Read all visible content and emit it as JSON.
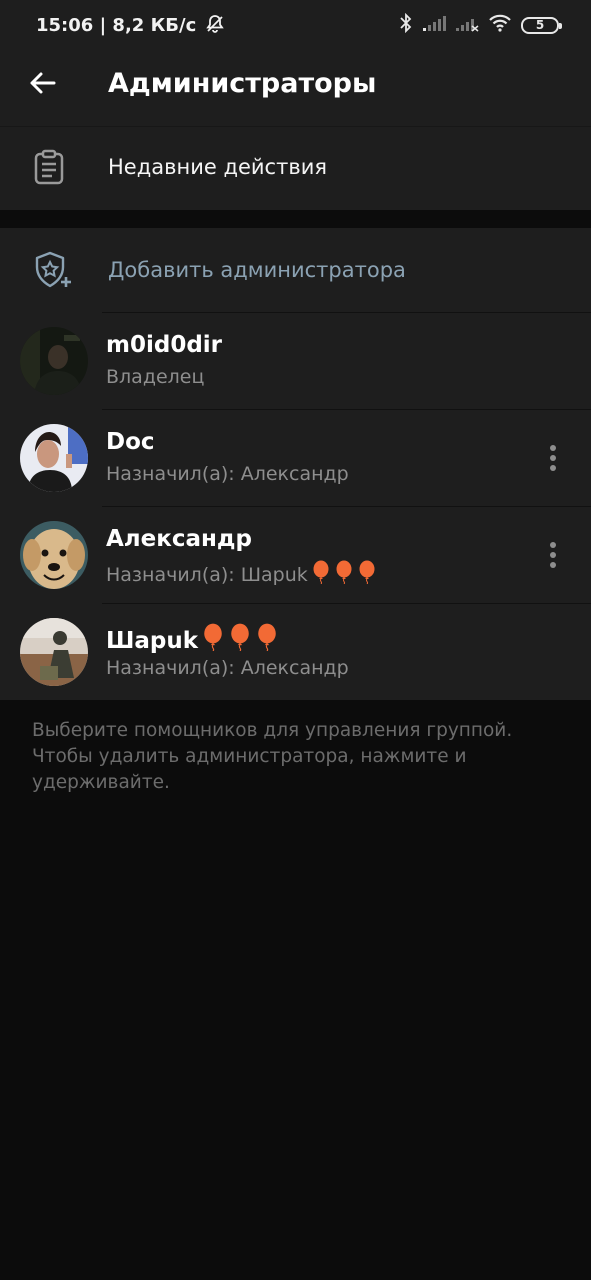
{
  "status_bar": {
    "time": "15:06",
    "speed": "| 8,2 КБ/с",
    "battery_level": "5"
  },
  "header": {
    "title": "Администраторы"
  },
  "recent_actions": {
    "label": "Недавние действия"
  },
  "add_admin": {
    "label": "Добавить администратора"
  },
  "admins": [
    {
      "name": "m0id0dir",
      "subtitle": "Владелец",
      "has_menu": false
    },
    {
      "name": "Doc",
      "subtitle": "Назначил(а): Александр",
      "has_menu": true
    },
    {
      "name": "Александр",
      "subtitle": "Назначил(а): Шарuk",
      "subtitle_suffix_icons": [
        "balloon-icon",
        "balloon-icon",
        "balloon-icon"
      ],
      "has_menu": true
    },
    {
      "name": "Шарuk",
      "name_suffix_icons": [
        "balloon-icon",
        "balloon-icon",
        "balloon-icon"
      ],
      "subtitle": "Назначил(а): Александр",
      "has_menu": false
    }
  ],
  "footer": {
    "note": "Выберите помощников для управления группой. Чтобы удалить администратора, нажмите и удерживайте."
  },
  "colors": {
    "surface": "#1e1e1e",
    "background": "#0c0c0c",
    "accent_muted": "#8ba2b3",
    "secondary_text": "#8e8e8e",
    "balloon": "#f26a35"
  }
}
